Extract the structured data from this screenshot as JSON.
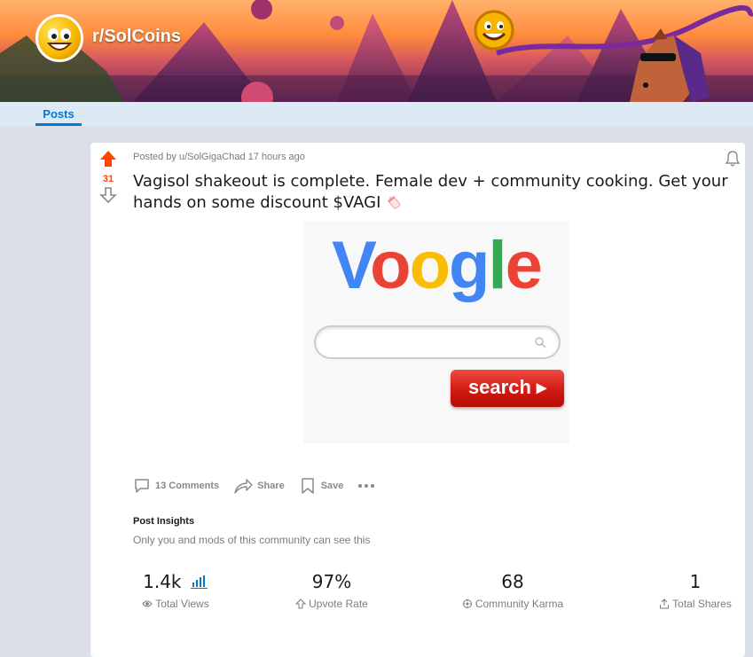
{
  "subreddit": {
    "name": "r/SolCoins"
  },
  "tabs": [
    {
      "label": "Posts",
      "active": true
    }
  ],
  "post": {
    "score": "31",
    "meta": "Posted by u/SolGigaChad 17 hours ago",
    "title": "Vagisol shakeout is complete. Female dev + community cooking. Get your hands on some discount $VAGI",
    "title_emoji": "baby-bottle-icon",
    "image": {
      "logo_text": "Voogle",
      "logo_colors": [
        "#4285f4",
        "#ea4335",
        "#fbbc05",
        "#4285f4",
        "#34a853",
        "#ea4335"
      ],
      "search_button_label": "search ▸"
    },
    "actions": {
      "comments": "13 Comments",
      "share": "Share",
      "save": "Save"
    },
    "insights": {
      "title": "Post Insights",
      "subtitle": "Only you and mods of this community can see this",
      "stats": [
        {
          "value": "1.4k",
          "label": "Total Views",
          "icon": "eye-icon"
        },
        {
          "value": "97%",
          "label": "Upvote Rate",
          "icon": "upvote-outline-icon"
        },
        {
          "value": "68",
          "label": "Community Karma",
          "icon": "karma-icon"
        },
        {
          "value": "1",
          "label": "Total Shares",
          "icon": "share-out-icon"
        }
      ]
    }
  },
  "colors": {
    "upvote": "#ff4500",
    "accent": "#0079d3",
    "page_bg": "#dae0e6",
    "tab_bg": "#dde9f5"
  }
}
